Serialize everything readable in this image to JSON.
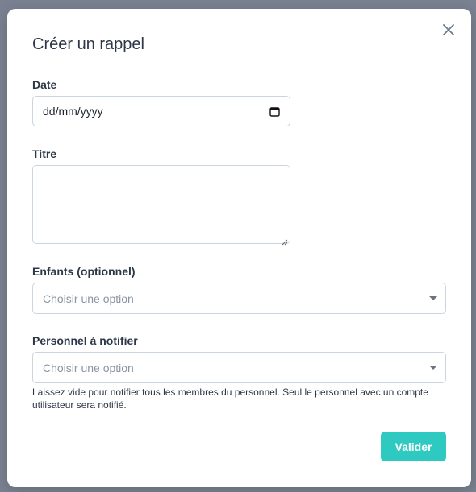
{
  "modal": {
    "title": "Créer un rappel",
    "close_icon": "close-icon"
  },
  "form": {
    "date": {
      "label": "Date",
      "value": "dd/mm/yyyy",
      "icon": "calendar-icon"
    },
    "title_field": {
      "label": "Titre",
      "value": ""
    },
    "children": {
      "label": "Enfants (optionnel)",
      "placeholder": "Choisir une option",
      "icon": "chevron-down-icon"
    },
    "staff": {
      "label": "Personnel à notifier",
      "placeholder": "Choisir une option",
      "icon": "chevron-down-icon",
      "help": "Laissez vide pour notifier tous les membres du personnel. Seul le personnel avec un compte utilisateur sera notifié."
    },
    "submit_label": "Valider"
  },
  "colors": {
    "accent": "#2ec9c0",
    "backdrop": "#7a8291",
    "border": "#cbd5e0",
    "text": "#2d3748",
    "placeholder": "#8a94a3"
  }
}
